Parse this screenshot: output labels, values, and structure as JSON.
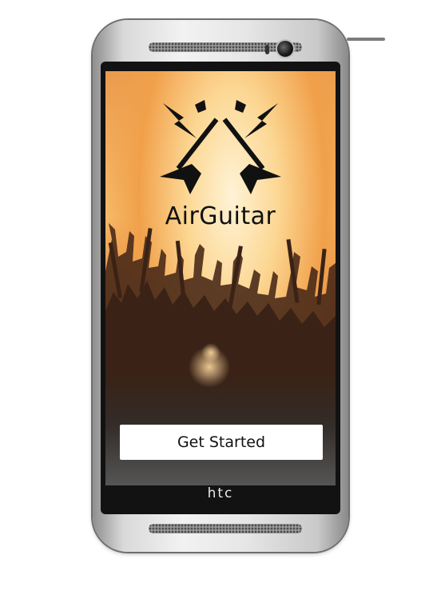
{
  "app": {
    "title": "AirGuitar",
    "cta_label": "Get Started"
  },
  "device": {
    "brand": "htc"
  },
  "icons": {
    "logo": "crossed-guitars-lightning-icon",
    "camera": "front-camera-icon"
  },
  "colors": {
    "screen_glow": "#fcd793",
    "screen_orange": "#f1a04a",
    "crowd": "#3a2216",
    "button_bg": "#ffffff",
    "title_text": "#111111"
  }
}
